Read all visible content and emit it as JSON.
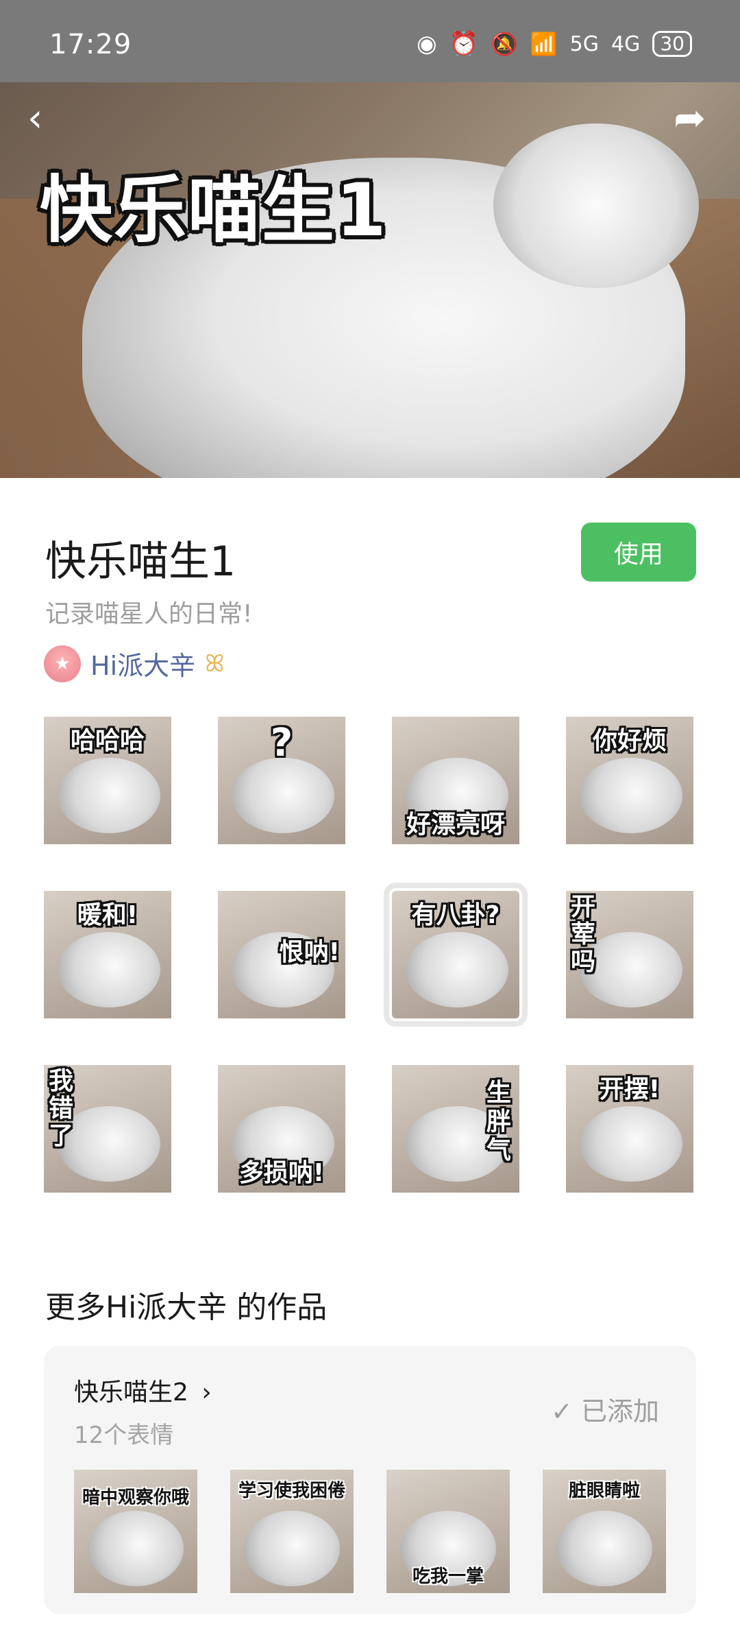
{
  "status": {
    "time": "17:29",
    "battery": "30",
    "net1": "5G",
    "net2": "4G"
  },
  "hero": {
    "title": "快乐喵生1"
  },
  "pack": {
    "title": "快乐喵生1",
    "use_label": "使用",
    "description": "记录喵星人的日常!",
    "author_name": "Hi派大辛",
    "accent_color": "#4dbf63"
  },
  "stickers": [
    {
      "caption": "哈哈哈"
    },
    {
      "caption": "?"
    },
    {
      "caption": "好漂亮呀"
    },
    {
      "caption": "你好烦"
    },
    {
      "caption": "暖和!"
    },
    {
      "caption": "恨呐!"
    },
    {
      "caption": "有八卦?"
    },
    {
      "caption": "开荤吗"
    },
    {
      "caption": "我错了"
    },
    {
      "caption": "多损呐!"
    },
    {
      "caption": "生胖气"
    },
    {
      "caption": "开摆!"
    }
  ],
  "more": {
    "title": "更多Hi派大辛 的作品",
    "card": {
      "name": "快乐喵生2",
      "count": "12个表情",
      "status": "已添加",
      "thumbs": [
        {
          "caption": "暗中观察你哦"
        },
        {
          "caption": "学习使我困倦"
        },
        {
          "caption": "吃我一掌"
        },
        {
          "caption": "脏眼睛啦"
        }
      ]
    }
  }
}
